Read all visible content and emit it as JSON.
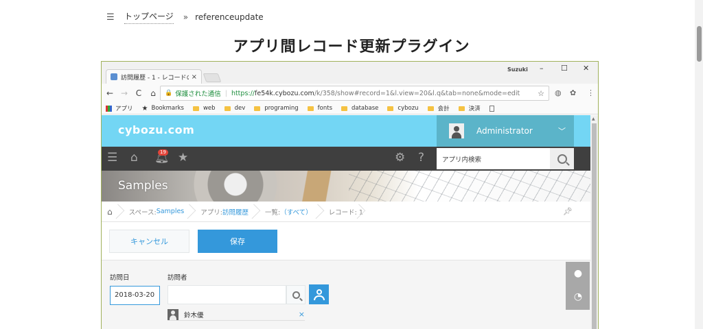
{
  "page": {
    "menu_icon": "hamburger-icon",
    "breadcrumb": {
      "home": "トップページ",
      "separator": "»",
      "current": "referenceupdate"
    },
    "title": "アプリ間レコード更新プラグイン"
  },
  "browser": {
    "tab_title": "訪問履歴 - 1 - レコードの詳",
    "tab_close": "×",
    "user": "Suzuki",
    "window_controls": {
      "minimize": "–",
      "maximize": "☐",
      "close": "✕"
    },
    "nav": {
      "back": "←",
      "forward": "→",
      "reload": "C",
      "home": "⌂"
    },
    "secure_label": "保護された通信",
    "url": {
      "protocol": "https://",
      "host": "fe54k.cybozu.com",
      "path": "/k/358/show#record=1&l.view=20&l.q&tab=none&mode=edit"
    },
    "bookmarks": [
      {
        "label": "アプリ",
        "icon": "apps-icon"
      },
      {
        "label": "Bookmarks",
        "icon": "star-icon"
      },
      {
        "label": "web",
        "icon": "folder-icon"
      },
      {
        "label": "dev",
        "icon": "folder-icon"
      },
      {
        "label": "programing",
        "icon": "folder-icon"
      },
      {
        "label": "fonts",
        "icon": "folder-icon"
      },
      {
        "label": "database",
        "icon": "folder-icon"
      },
      {
        "label": "cybozu",
        "icon": "folder-icon"
      },
      {
        "label": "会計",
        "icon": "folder-icon"
      },
      {
        "label": "決済",
        "icon": "folder-icon"
      }
    ]
  },
  "kintone": {
    "logo": "cybozu.com",
    "user_name": "Administrator",
    "notification_count": "19",
    "search_placeholder": "アプリ内検索",
    "space_title": "Samples",
    "breadcrumb": {
      "space_label": "スペース: ",
      "space_link": "Samples",
      "app_label": "アプリ: ",
      "app_link": "訪問履歴",
      "list_label": "一覧: ",
      "list_link": "（すべて）",
      "record_label": "レコード: 1"
    },
    "actions": {
      "cancel": "キャンセル",
      "save": "保存"
    },
    "form": {
      "visit_date_label": "訪問日",
      "visit_date_value": "2018-03-20",
      "visitor_label": "訪問者",
      "visitor_selected": "鈴木優",
      "remove_symbol": "×"
    }
  },
  "colors": {
    "header_blue": "#73d6f4",
    "user_panel": "#5bb4c9",
    "nav_dark": "#3f3f3f",
    "accent_blue": "#3498db",
    "badge_red": "#e3453a"
  }
}
